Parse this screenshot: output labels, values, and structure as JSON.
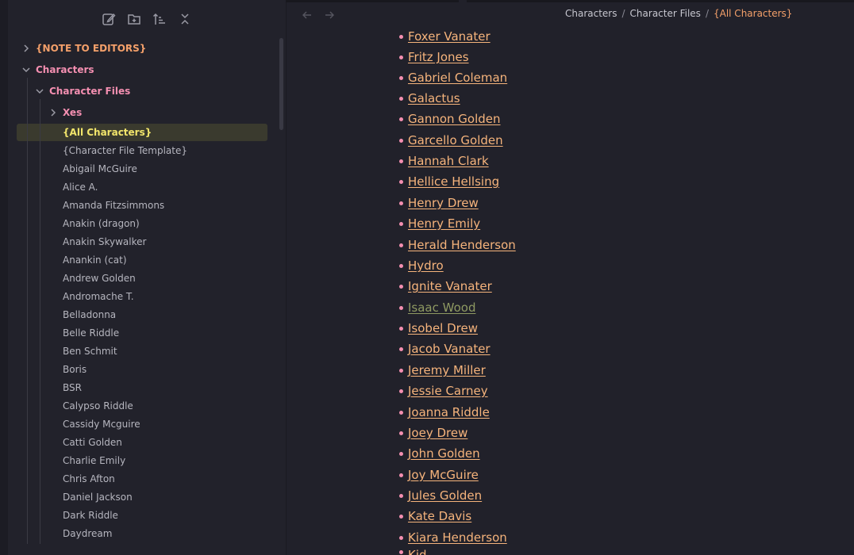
{
  "toolbar": {
    "new_note_icon": "edit-icon",
    "new_folder_icon": "folder-plus-icon",
    "sort_icon": "sort-icon",
    "collapse_icon": "collapse-all-icon"
  },
  "tree": {
    "note_to_editors": "{NOTE TO EDITORS}",
    "characters": "Characters",
    "character_files": "Character Files",
    "xes": "Xes",
    "all_characters": "{All Characters}",
    "files": [
      "{Character File Template}",
      "Abigail McGuire",
      "Alice A.",
      "Amanda Fitzsimmons",
      "Anakin (dragon)",
      "Anakin Skywalker",
      "Anankin (cat)",
      "Andrew Golden",
      "Andromache T.",
      "Belladonna",
      "Belle Riddle",
      "Ben Schmit",
      "Boris",
      "BSR",
      "Calypso Riddle",
      "Cassidy Mcguire",
      "Catti Golden",
      "Charlie Emily",
      "Chris Afton",
      "Daniel Jackson",
      "Dark Riddle",
      "Daydream"
    ]
  },
  "breadcrumb": {
    "items": [
      "Characters",
      "Character Files"
    ],
    "current": "{All Characters}",
    "separator": "/"
  },
  "content": {
    "links": [
      "Foxer Vanater",
      "Fritz Jones",
      "Gabriel Coleman",
      "Galactus",
      "Gannon Golden",
      "Garcello Golden",
      "Hannah Clark",
      "Hellice Hellsing",
      "Henry Drew",
      "Henry Emily",
      "Herald Henderson",
      "Hydro",
      "Ignite Vanater",
      "Isaac Wood",
      "Isobel Drew",
      "Jacob Vanater",
      "Jeremy Miller",
      "Jessie Carney",
      "Joanna Riddle",
      "Joey Drew",
      "John Golden",
      "Joy McGuire",
      "Jules Golden",
      "Kate Davis",
      "Kiara Henderson",
      "Kid"
    ],
    "visited_link": "Isaac Wood"
  },
  "colors": {
    "background": "#21212a",
    "sidebar": "#22222b",
    "folder_pink": "#f48fb1",
    "folder_orange": "#f4a06a",
    "active_yellow": "#f2e56b",
    "link": "#f6b47c",
    "visited_link": "#8f9a62",
    "bullet": "#f48fb1"
  }
}
